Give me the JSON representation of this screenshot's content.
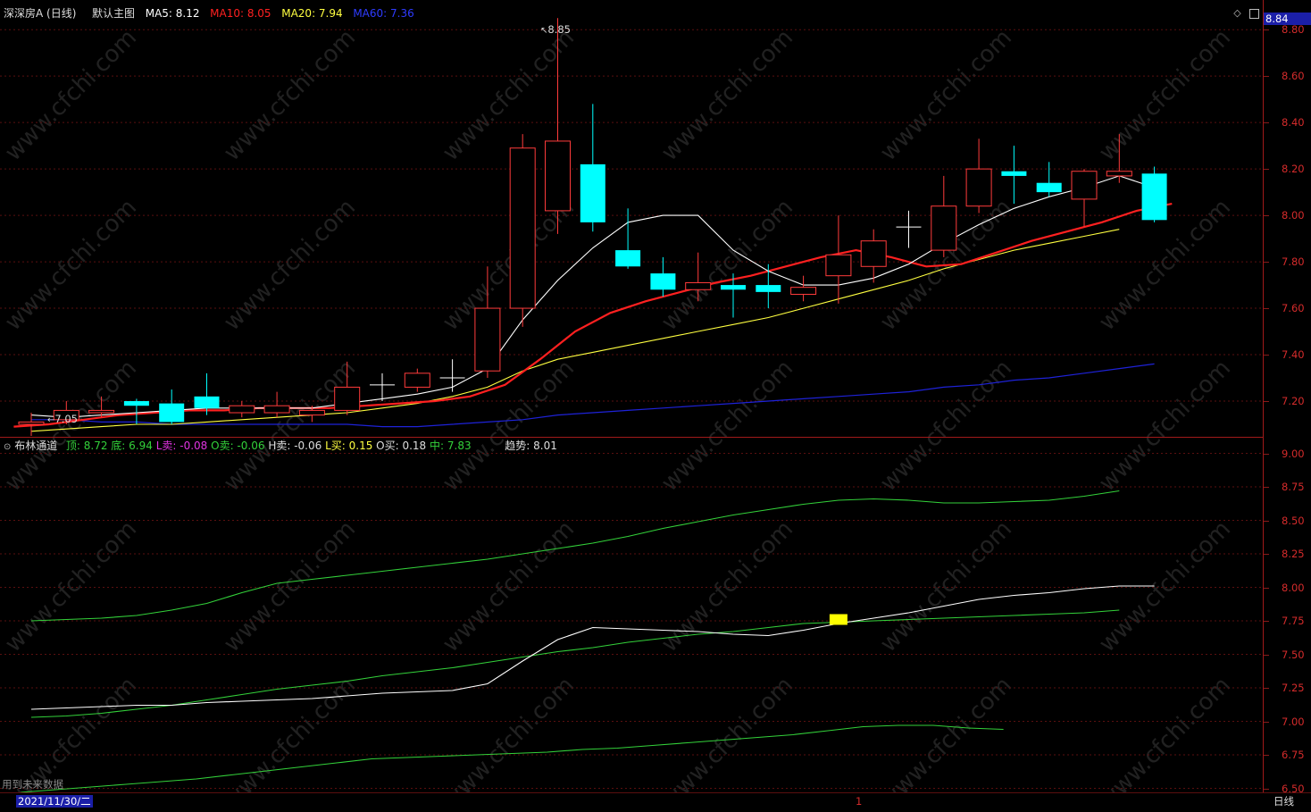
{
  "colors": {
    "ma5": "#ffffff",
    "ma10": "#ff2020",
    "ma20": "#ffff40",
    "ma60": "#1e22d8",
    "up": "#ff3b3b",
    "down": "#00ffff",
    "axis": "#d42b2b",
    "grid": "#5a0f0f",
    "band": "#33d13a",
    "mid": "#ffffff"
  },
  "header": {
    "stock": "深深房A (日线)",
    "main_label": "默认主图",
    "ma5": "MA5: 8.12",
    "ma10": "MA10: 8.05",
    "ma20": "MA20: 7.94",
    "ma60": "MA60: 7.36",
    "current_price": "8.84",
    "high_label": "8.85",
    "low_label": "7.05",
    "icons": [
      "diamond-icon",
      "panel-icon"
    ]
  },
  "indicator": {
    "name": "布林通道",
    "top": "顶: 8.72",
    "bottom": "底: 6.94",
    "l_sell": "L卖: -0.08",
    "o_sell": "O卖: -0.06",
    "h_sell": "H卖: -0.06",
    "l_buy": "L买: 0.15",
    "o_buy": "O买: 0.18",
    "mid": "中: 7.83",
    "trend": "趋势: 8.01",
    "future_note": "用到未来数据"
  },
  "price_axis": [
    "8.80",
    "8.60",
    "8.40",
    "8.20",
    "8.00",
    "7.80",
    "7.60",
    "7.40",
    "7.20"
  ],
  "ind_axis": [
    "9.00",
    "8.75",
    "8.50",
    "8.25",
    "8.00",
    "7.75",
    "7.50",
    "7.25",
    "7.00",
    "6.75",
    "6.50"
  ],
  "footer": {
    "date": "2021/11/30/二",
    "period": "日线",
    "marker": "1"
  },
  "watermark": "www.cfchi.com",
  "chart_data": {
    "type": "candlestick",
    "candles": [
      {
        "o": 7.1,
        "c": 7.11,
        "h": 7.15,
        "l": 7.05
      },
      {
        "o": 7.12,
        "c": 7.16,
        "h": 7.2,
        "l": 7.1
      },
      {
        "o": 7.15,
        "c": 7.16,
        "h": 7.22,
        "l": 7.13
      },
      {
        "o": 7.2,
        "c": 7.18,
        "h": 7.21,
        "l": 7.1
      },
      {
        "o": 7.19,
        "c": 7.11,
        "h": 7.25,
        "l": 7.1
      },
      {
        "o": 7.22,
        "c": 7.17,
        "h": 7.32,
        "l": 7.14
      },
      {
        "o": 7.15,
        "c": 7.18,
        "h": 7.2,
        "l": 7.13
      },
      {
        "o": 7.15,
        "c": 7.18,
        "h": 7.24,
        "l": 7.13
      },
      {
        "o": 7.14,
        "c": 7.16,
        "h": 7.18,
        "l": 7.11
      },
      {
        "o": 7.16,
        "c": 7.26,
        "h": 7.37,
        "l": 7.14
      },
      {
        "o": 7.27,
        "c": 7.27,
        "h": 7.32,
        "l": 7.2
      },
      {
        "o": 7.26,
        "c": 7.32,
        "h": 7.34,
        "l": 7.24
      },
      {
        "o": 7.3,
        "c": 7.3,
        "h": 7.38,
        "l": 7.24
      },
      {
        "o": 7.33,
        "c": 7.6,
        "h": 7.78,
        "l": 7.3
      },
      {
        "o": 7.6,
        "c": 8.29,
        "h": 8.35,
        "l": 7.52
      },
      {
        "o": 8.02,
        "c": 8.32,
        "h": 8.85,
        "l": 7.92
      },
      {
        "o": 8.22,
        "c": 7.97,
        "h": 8.48,
        "l": 7.93
      },
      {
        "o": 7.85,
        "c": 7.78,
        "h": 8.03,
        "l": 7.77
      },
      {
        "o": 7.75,
        "c": 7.68,
        "h": 7.82,
        "l": 7.65
      },
      {
        "o": 7.68,
        "c": 7.71,
        "h": 7.84,
        "l": 7.63
      },
      {
        "o": 7.7,
        "c": 7.68,
        "h": 7.75,
        "l": 7.56
      },
      {
        "o": 7.7,
        "c": 7.67,
        "h": 7.79,
        "l": 7.6
      },
      {
        "o": 7.66,
        "c": 7.69,
        "h": 7.74,
        "l": 7.63
      },
      {
        "o": 7.74,
        "c": 7.83,
        "h": 8.0,
        "l": 7.62
      },
      {
        "o": 7.78,
        "c": 7.89,
        "h": 7.94,
        "l": 7.71
      },
      {
        "o": 7.95,
        "c": 7.95,
        "h": 8.02,
        "l": 7.86
      },
      {
        "o": 7.85,
        "c": 8.04,
        "h": 8.17,
        "l": 7.82
      },
      {
        "o": 8.04,
        "c": 8.2,
        "h": 8.33,
        "l": 8.01
      },
      {
        "o": 8.19,
        "c": 8.17,
        "h": 8.3,
        "l": 8.05
      },
      {
        "o": 8.14,
        "c": 8.1,
        "h": 8.23,
        "l": 8.08
      },
      {
        "o": 8.07,
        "c": 8.19,
        "h": 8.2,
        "l": 7.95
      },
      {
        "o": 8.17,
        "c": 8.19,
        "h": 8.35,
        "l": 8.14
      },
      {
        "o": 8.18,
        "c": 7.98,
        "h": 8.21,
        "l": 7.97
      }
    ],
    "ma5": [
      7.14,
      7.13,
      7.14,
      7.15,
      7.16,
      7.17,
      7.17,
      7.17,
      7.17,
      7.19,
      7.21,
      7.23,
      7.26,
      7.34,
      7.55,
      7.72,
      7.86,
      7.97,
      8.0,
      8.0,
      7.85,
      7.76,
      7.7,
      7.7,
      7.73,
      7.79,
      7.88,
      7.96,
      8.03,
      8.08,
      8.12,
      8.17,
      8.12
    ],
    "ma10": [
      7.09,
      7.1,
      7.12,
      7.14,
      7.15,
      7.16,
      7.16,
      7.17,
      7.17,
      7.17,
      7.18,
      7.19,
      7.2,
      7.22,
      7.27,
      7.38,
      7.5,
      7.58,
      7.63,
      7.67,
      7.71,
      7.74,
      7.78,
      7.82,
      7.85,
      7.82,
      7.78,
      7.79,
      7.84,
      7.89,
      7.93,
      7.97,
      8.02,
      8.05
    ],
    "ma20": [
      7.07,
      7.08,
      7.09,
      7.1,
      7.1,
      7.11,
      7.12,
      7.13,
      7.14,
      7.15,
      7.17,
      7.19,
      7.22,
      7.26,
      7.33,
      7.38,
      7.41,
      7.44,
      7.47,
      7.5,
      7.53,
      7.56,
      7.6,
      7.64,
      7.68,
      7.72,
      7.77,
      7.81,
      7.85,
      7.88,
      7.91,
      7.94
    ],
    "ma60": [
      7.12,
      7.12,
      7.11,
      7.11,
      7.1,
      7.1,
      7.1,
      7.1,
      7.1,
      7.1,
      7.09,
      7.09,
      7.1,
      7.11,
      7.12,
      7.14,
      7.15,
      7.16,
      7.17,
      7.18,
      7.19,
      7.2,
      7.21,
      7.22,
      7.23,
      7.24,
      7.26,
      7.27,
      7.29,
      7.3,
      7.32,
      7.34,
      7.36
    ],
    "boll_top": [
      7.75,
      7.76,
      7.77,
      7.79,
      7.83,
      7.88,
      7.96,
      8.03,
      8.06,
      8.09,
      8.12,
      8.15,
      8.18,
      8.21,
      8.25,
      8.29,
      8.33,
      8.38,
      8.44,
      8.49,
      8.54,
      8.58,
      8.62,
      8.65,
      8.66,
      8.65,
      8.63,
      8.63,
      8.64,
      8.65,
      8.68,
      8.72
    ],
    "boll_mid": [
      7.09,
      7.1,
      7.11,
      7.12,
      7.12,
      7.14,
      7.15,
      7.16,
      7.17,
      7.19,
      7.21,
      7.22,
      7.23,
      7.28,
      7.45,
      7.61,
      7.7,
      7.69,
      7.68,
      7.67,
      7.65,
      7.64,
      7.68,
      7.73,
      7.77,
      7.81,
      7.86,
      7.91,
      7.94,
      7.96,
      7.99,
      8.01,
      8.01
    ],
    "boll_mid2": [
      7.03,
      7.04,
      7.06,
      7.09,
      7.12,
      7.16,
      7.2,
      7.24,
      7.27,
      7.3,
      7.34,
      7.37,
      7.4,
      7.44,
      7.48,
      7.52,
      7.55,
      7.59,
      7.62,
      7.65,
      7.67,
      7.7,
      7.73,
      7.74,
      7.75,
      7.76,
      7.77,
      7.78,
      7.79,
      7.8,
      7.81,
      7.83
    ],
    "boll_bot": [
      6.47,
      6.49,
      6.51,
      6.53,
      6.55,
      6.57,
      6.6,
      6.63,
      6.66,
      6.69,
      6.72,
      6.73,
      6.74,
      6.75,
      6.76,
      6.77,
      6.79,
      6.8,
      6.82,
      6.84,
      6.86,
      6.88,
      6.9,
      6.93,
      6.96,
      6.97,
      6.97,
      6.95,
      6.94
    ],
    "signal_box": {
      "x_index": 23,
      "y": 7.76
    },
    "ylim_price": [
      7.05,
      8.87
    ],
    "ylim_ind": [
      6.45,
      9.05
    ]
  }
}
